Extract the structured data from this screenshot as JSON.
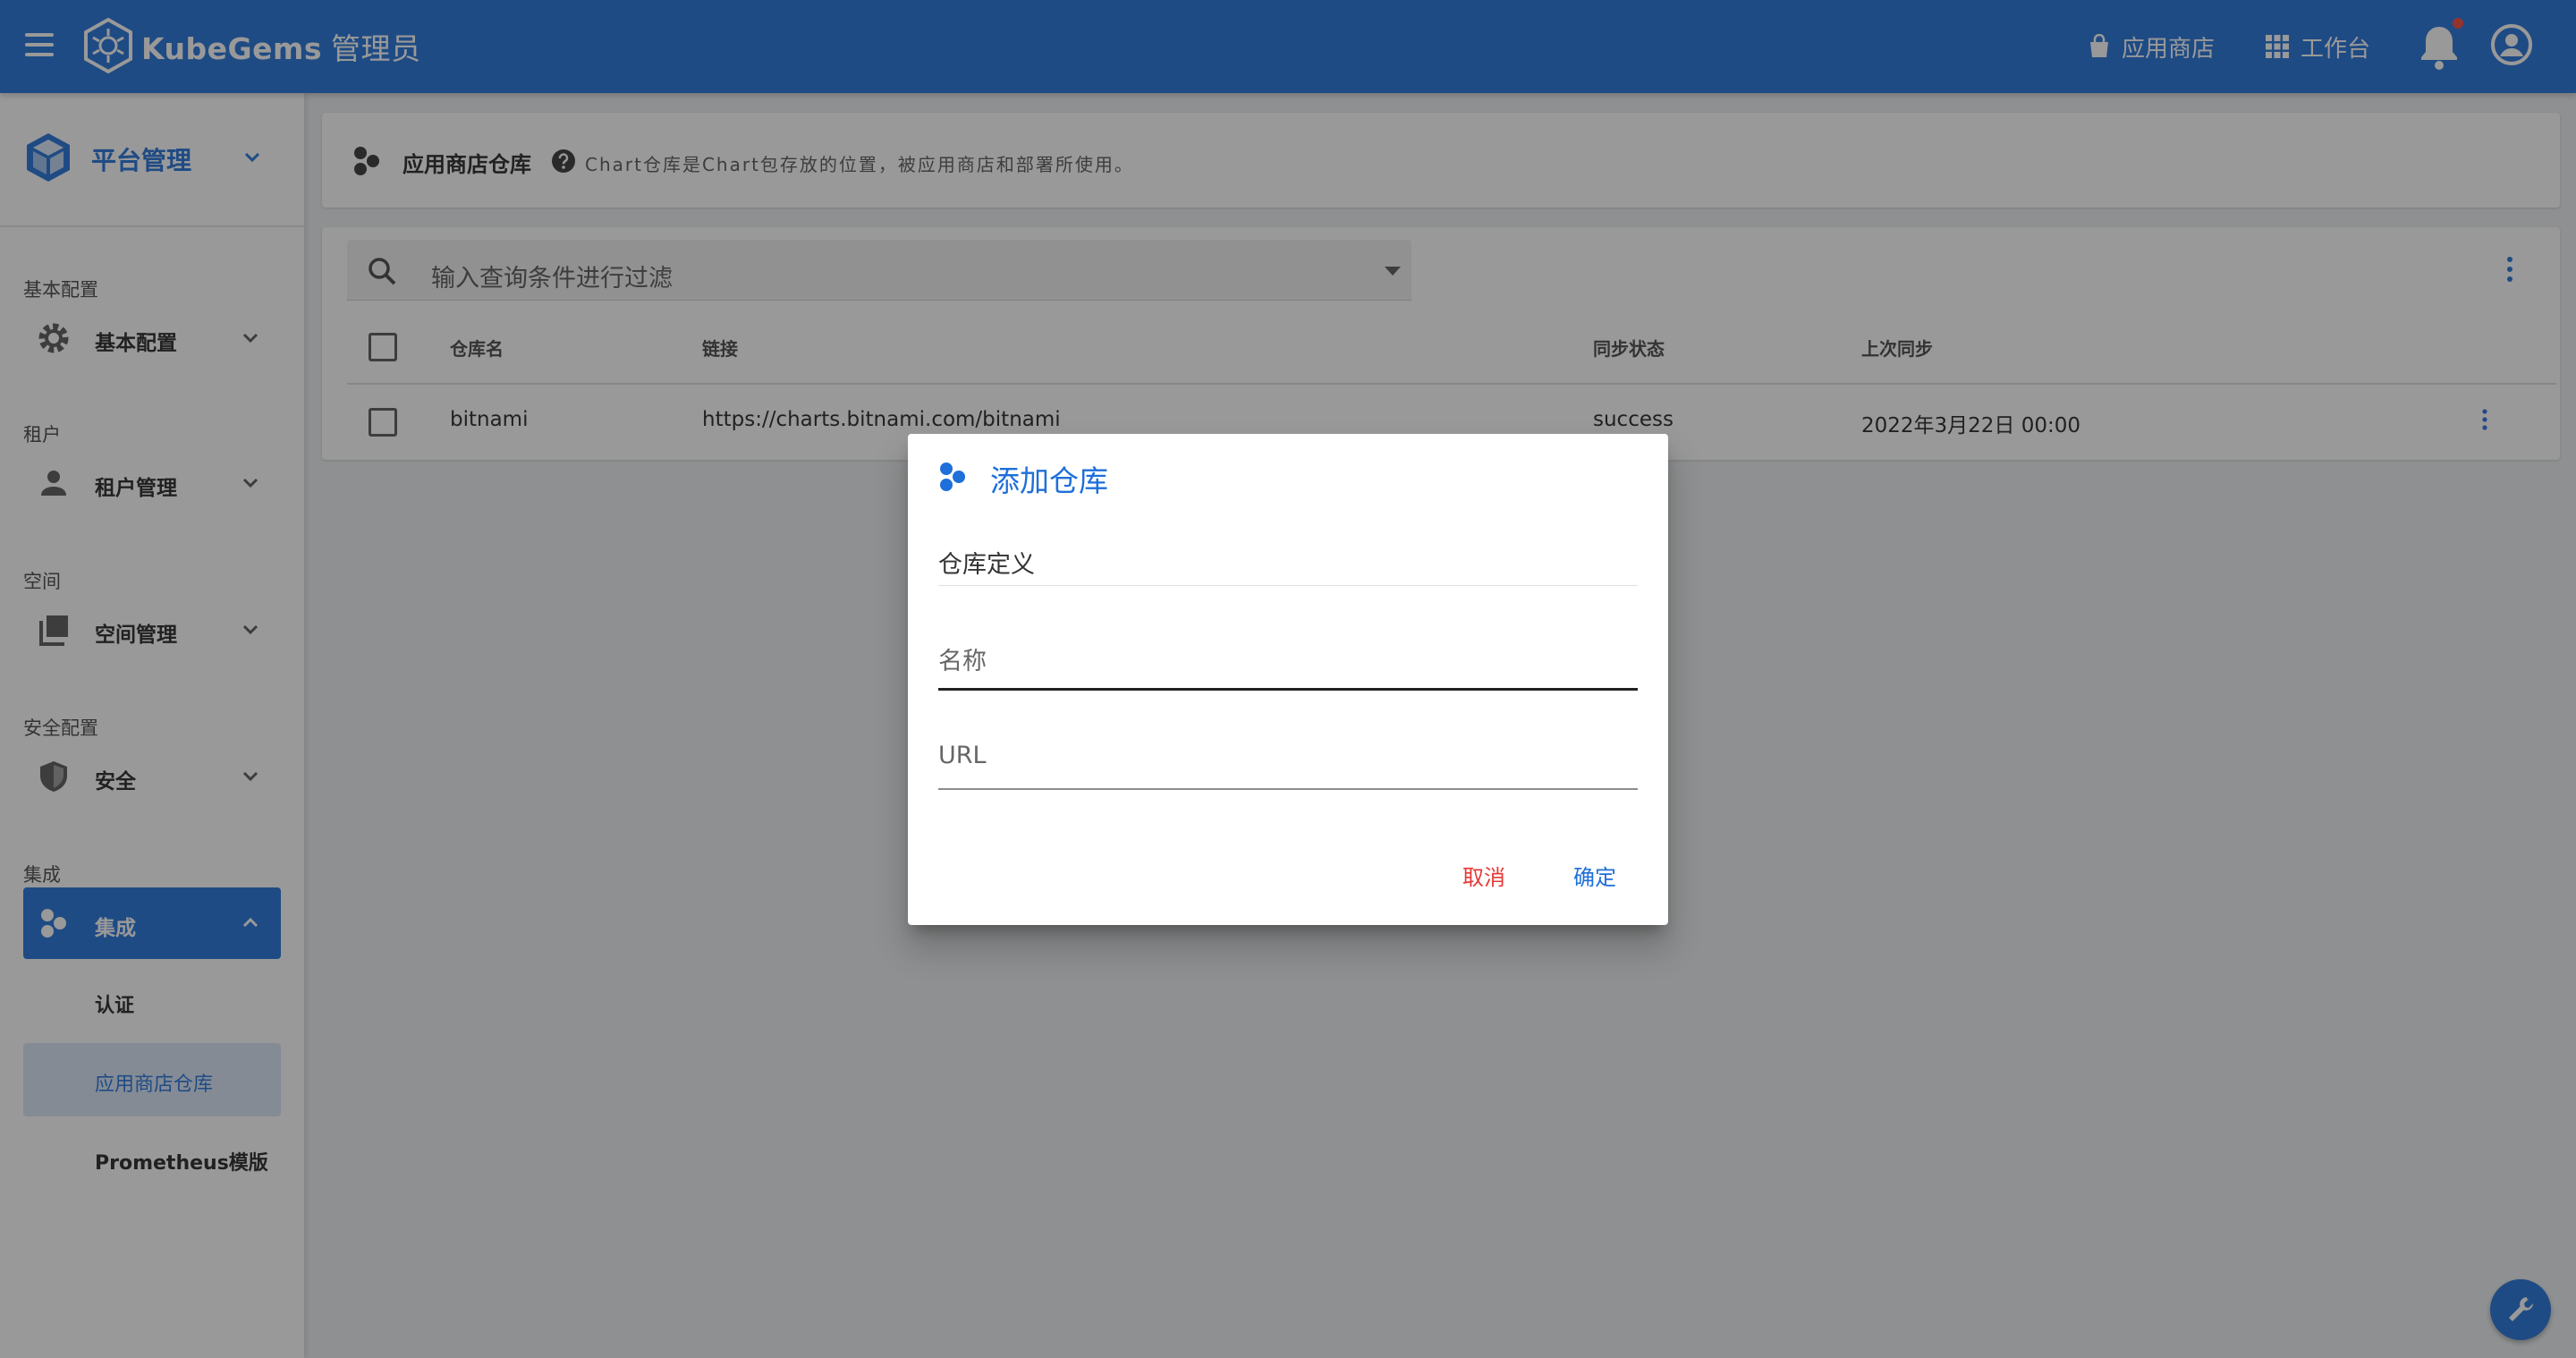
{
  "appbar": {
    "brand": "KubeGems",
    "role": "管理员",
    "store_label": "应用商店",
    "workbench_label": "工作台"
  },
  "sidebar": {
    "header_title": "平台管理",
    "groups": [
      {
        "section": "基本配置",
        "label": "基本配置",
        "icon": "gear-icon"
      },
      {
        "section": "租户",
        "label": "租户管理",
        "icon": "person-icon"
      },
      {
        "section": "空间",
        "label": "空间管理",
        "icon": "layers-icon"
      },
      {
        "section": "安全配置",
        "label": "安全",
        "icon": "shield-icon"
      },
      {
        "section": "集成",
        "label": "集成",
        "icon": "hexagons-icon"
      }
    ],
    "sub_items": [
      {
        "label": "认证"
      },
      {
        "label": "应用商店仓库"
      },
      {
        "label": "Prometheus模版"
      }
    ]
  },
  "page": {
    "title": "应用商店仓库",
    "hint": "Chart仓库是Chart包存放的位置，被应用商店和部署所使用。"
  },
  "filter": {
    "placeholder": "输入查询条件进行过滤"
  },
  "table": {
    "headers": [
      "仓库名",
      "链接",
      "同步状态",
      "上次同步"
    ],
    "rows": [
      {
        "name": "bitnami",
        "url": "https://charts.bitnami.com/bitnami",
        "status": "success",
        "last_sync": "2022年3月22日 00:00"
      }
    ]
  },
  "dialog": {
    "title": "添加仓库",
    "section": "仓库定义",
    "name_placeholder": "名称",
    "url_placeholder": "URL",
    "cancel_label": "取消",
    "ok_label": "确定"
  },
  "colors": {
    "primary": "#1e6fd9",
    "cancel": "#e53935",
    "notification": "#f44336"
  }
}
